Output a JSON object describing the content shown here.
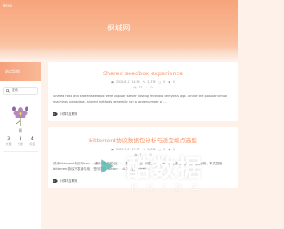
{
  "header": {
    "brand": "Hexo",
    "site_title": "枫城网"
  },
  "sidebar": {
    "header": "站点导航",
    "search_placeholder": "搜索",
    "profile_name": "枫",
    "stats": [
      {
        "value": "3",
        "label": "文章"
      },
      {
        "value": "3",
        "label": "分类"
      },
      {
        "value": "4",
        "label": "标签"
      }
    ]
  },
  "posts": [
    {
      "title": "Shared seedbox experience",
      "date": "2024-8-17 14:54",
      "words": "2,379",
      "comments": "0",
      "views": "0",
      "reads": "77",
      "likes": "0",
      "excerpt": "Shared host and shared seedbox were popular server hosting methods ten years ago. Unlike the popular virtual machines nowadays, shared methods generally run a large number of ...",
      "tag": "计算机互联网"
    },
    {
      "title": "bittorrent协议数据包分析与适宜端点选型",
      "date": "2023-7-07 17:57",
      "words": "2,818",
      "comments": "0",
      "views": "0",
      "reads": "7",
      "likes": "0",
      "excerpt": "关于bittorrent协议与tracker通讯中使用的包结构、数据与下载客户端、以及传输节点上的端点选择问题的分析，本文围绕bittorrent协议开发者与用户进行讨论。bittorrent4.3.2 (以下简称)...",
      "tag": "计算机互联网"
    }
  ],
  "watermark": {
    "text": "酷数据",
    "subtext": "KUIDC"
  },
  "colors": {
    "accent": "#f4956a",
    "banner_top": "#f7a47c",
    "background": "#fdf1ea"
  }
}
